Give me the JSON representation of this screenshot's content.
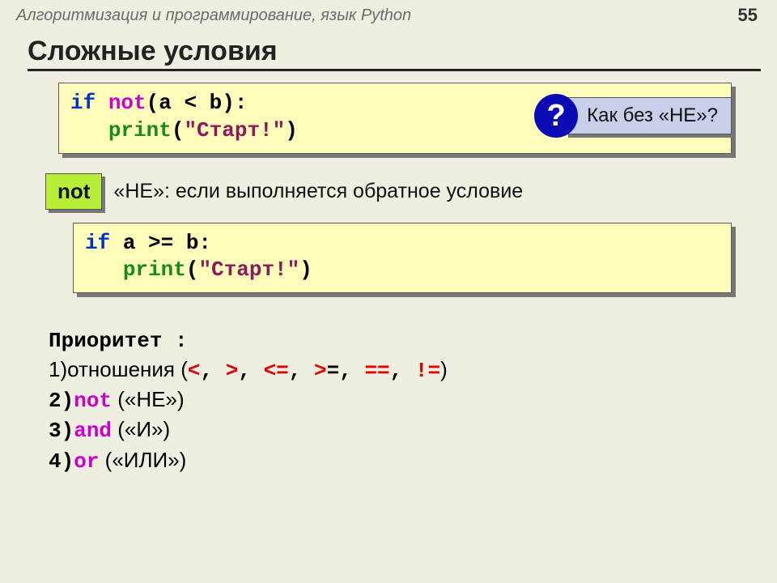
{
  "header": {
    "subject": "Алгоритмизация и программирование, язык Python",
    "page": "55"
  },
  "title": "Сложные условия",
  "code1": {
    "kw_if": "if",
    "kw_not": " not",
    "after_not": "(a < b):",
    "indent": "   ",
    "kw_print": "print",
    "print_open": "(",
    "str": "\"Старт!\"",
    "print_close": ")"
  },
  "question": {
    "mark": "?",
    "text": " Как без «НЕ»?"
  },
  "not_row": {
    "badge": "not",
    "text": "«НЕ»: если выполняется обратное условие"
  },
  "code2": {
    "kw_if": "if",
    "cond": " a >= b:",
    "indent": "   ",
    "kw_print": "print",
    "print_open": "(",
    "str": "\"Старт!\"",
    "print_close": ")"
  },
  "priority": {
    "heading": "Приоритет :",
    "l1_prefix": "1)отношения (",
    "l1_ops": {
      "lt": "<",
      "c1": ", ",
      "gt": ">",
      "c2": ", ",
      "le": "<=",
      "c3": ", ",
      "ge_tail": ">",
      "ge_eq": "=",
      "c4": ", ",
      "eq": "==",
      "c5": ", ",
      "ne": "!="
    },
    "l1_suffix": ")",
    "l2_num": "2)",
    "l2_kw": "not",
    "l2_txt": " («НЕ»)",
    "l3_num": "3)",
    "l3_kw": "and",
    "l3_txt": " («И»)",
    "l4_num": "4)",
    "l4_kw": "or",
    "l4_txt": " («ИЛИ»)"
  }
}
